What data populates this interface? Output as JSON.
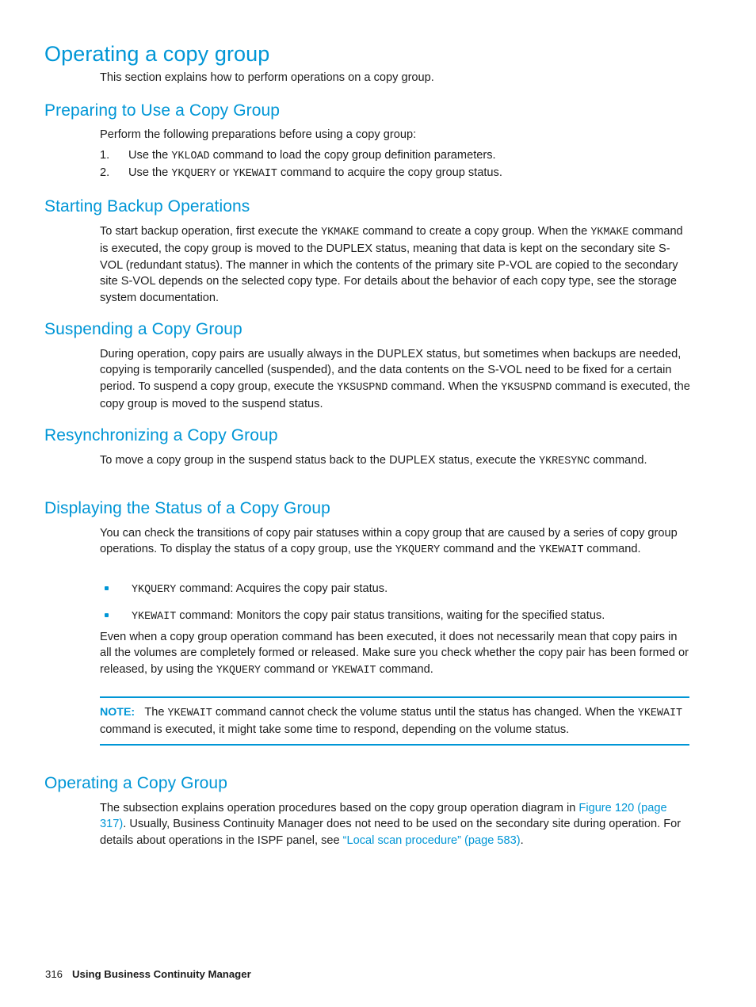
{
  "page": {
    "title": "Operating a copy group",
    "intro": "This section explains how to perform operations on a copy group."
  },
  "sections": {
    "preparing": {
      "heading": "Preparing to Use a Copy Group",
      "lead": "Perform the following preparations before using a copy group:",
      "steps": [
        {
          "number": "1.",
          "pre": "Use the ",
          "cmd": "YKLOAD",
          "post": " command to load the copy group definition parameters."
        },
        {
          "number": "2.",
          "pre": "Use the ",
          "cmd": "YKQUERY",
          "mid": " or ",
          "cmd2": "YKEWAIT",
          "post": " command to acquire the copy group status."
        }
      ]
    },
    "starting_backup": {
      "heading": "Starting Backup Operations",
      "p1_a": "To start backup operation, first execute the ",
      "p1_cmd1": "YKMAKE",
      "p1_b": " command to create a copy group. When the ",
      "p1_cmd2": "YKMAKE",
      "p1_c": " command is executed, the copy group is moved to the DUPLEX status, meaning that data is kept on the secondary site S-VOL (redundant status). The manner in which the contents of the primary site P-VOL are copied to the secondary site S-VOL depends on the selected copy type. For details about the behavior of each copy type, see the storage system documentation."
    },
    "suspending": {
      "heading": "Suspending a Copy Group",
      "p1_a": "During operation, copy pairs are usually always in the DUPLEX status, but sometimes when backups are needed, copying is temporarily cancelled (suspended), and the data contents on the S-VOL need to be fixed for a certain period. To suspend a copy group, execute the ",
      "p1_cmd1": "YKSUSPND",
      "p1_b": " command. When the ",
      "p1_cmd2": "YKSUSPND",
      "p1_c": " command is executed, the copy group is moved to the suspend status."
    },
    "resynchronizing": {
      "heading": "Resynchronizing a Copy Group",
      "p1_a": "To move a copy group in the suspend status back to the DUPLEX status, execute the ",
      "p1_cmd1": "YKRESYNC",
      "p1_b": " command."
    },
    "displaying_status": {
      "heading": "Displaying the Status of a Copy Group",
      "p1_a": "You can check the transitions of copy pair statuses within a copy group that are caused by a series of copy group operations. To display the status of a copy group, use the ",
      "p1_cmd1": "YKQUERY",
      "p1_b": " command and the ",
      "p1_cmd2": "YKEWAIT",
      "p1_c": " command.",
      "bullets": [
        {
          "cmd": "YKQUERY",
          "text": " command: Acquires the copy pair status."
        },
        {
          "cmd": "YKEWAIT",
          "text": " command: Monitors the copy pair status transitions, waiting for the specified status."
        }
      ],
      "p2_a": "Even when a copy group operation command has been executed, it does not necessarily mean that copy pairs in all the volumes are completely formed or released. Make sure you check whether the copy pair has been formed or released, by using the ",
      "p2_cmd1": "YKQUERY",
      "p2_b": " command or ",
      "p2_cmd2": "YKEWAIT",
      "p2_c": " command.",
      "note": {
        "label": "NOTE:",
        "a": "The ",
        "cmd1": "YKEWAIT",
        "b": " command cannot check the volume status until the status has changed. When the ",
        "cmd2": "YKEWAIT",
        "c": " command is executed, it might take some time to respond, depending on the volume status."
      }
    },
    "operating": {
      "heading": "Operating a Copy Group",
      "p1_a": "The subsection explains operation procedures based on the copy group operation diagram in ",
      "link1": "Figure 120 (page 317)",
      "p1_b": ". Usually, Business Continuity Manager does not need to be used on the secondary site during operation. For details about operations in the ISPF panel, see ",
      "link2": "“Local scan procedure” (page 583)",
      "p1_c": "."
    }
  },
  "footer": {
    "page_number": "316",
    "title": "Using Business Continuity Manager"
  },
  "colors": {
    "heading_blue": "#0096d6",
    "link_blue": "#0096d6",
    "body_black": "#1c1c1c"
  }
}
